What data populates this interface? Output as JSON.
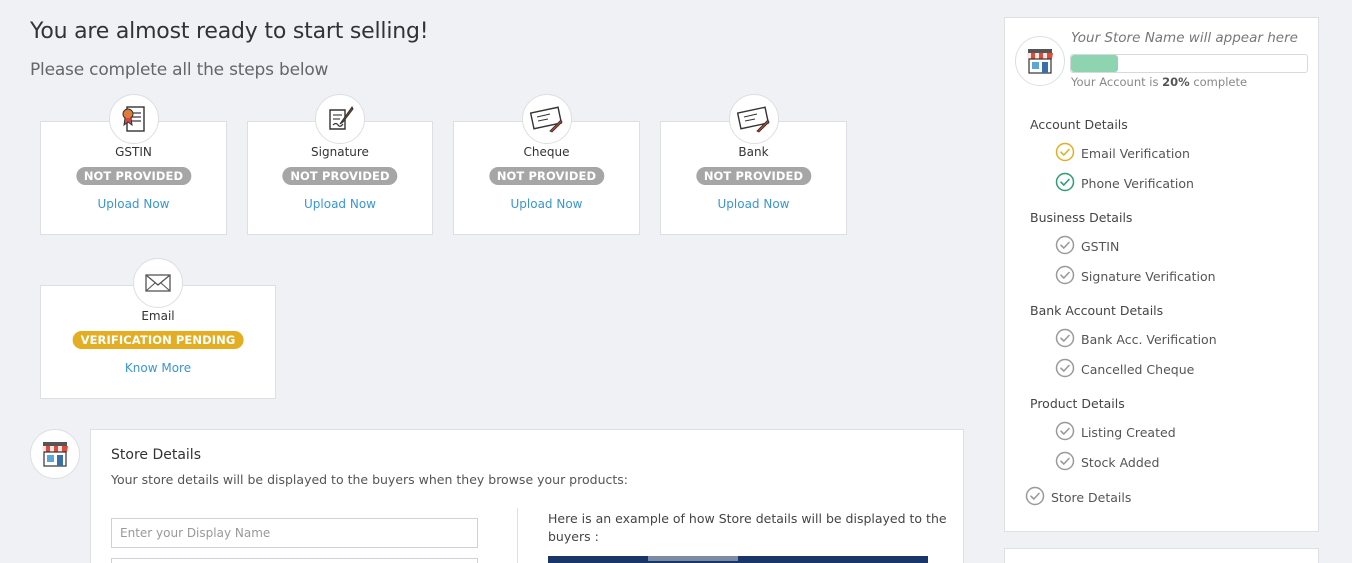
{
  "page": {
    "heading": "You are almost ready to start selling!",
    "subheading": "Please complete all the steps below"
  },
  "cards": [
    {
      "title": "GSTIN",
      "status": "NOT PROVIDED",
      "link": "Upload Now",
      "icon": "certificate-icon"
    },
    {
      "title": "Signature",
      "status": "NOT PROVIDED",
      "link": "Upload Now",
      "icon": "signature-pen-icon"
    },
    {
      "title": "Cheque",
      "status": "NOT PROVIDED",
      "link": "Upload Now",
      "icon": "cheque-icon"
    },
    {
      "title": "Bank",
      "status": "NOT PROVIDED",
      "link": "Upload Now",
      "icon": "bank-cheque-icon"
    },
    {
      "title": "Email",
      "status": "VERIFICATION PENDING",
      "link": "Know More",
      "icon": "envelope-icon"
    }
  ],
  "store": {
    "title": "Store Details",
    "description": "Your store details will be displayed to the buyers when they browse your products:",
    "display_name_placeholder": "Enter your Display Name",
    "example_text": "Here is an example of how Store details will be displayed to the buyers :"
  },
  "sidebar": {
    "store_name_placeholder": "Your Store Name will appear here",
    "progress_prefix": "Your Account is ",
    "progress_percent_label": "20%",
    "progress_suffix": " complete",
    "progress_fraction": 0.2,
    "sections": [
      {
        "label": "Account Details",
        "items": [
          {
            "label": "Email Verification",
            "state": "pending"
          },
          {
            "label": "Phone Verification",
            "state": "done"
          }
        ]
      },
      {
        "label": "Business Details",
        "items": [
          {
            "label": "GSTIN",
            "state": "todo"
          },
          {
            "label": "Signature Verification",
            "state": "todo"
          }
        ]
      },
      {
        "label": "Bank Account Details",
        "items": [
          {
            "label": "Bank Acc. Verification",
            "state": "todo"
          },
          {
            "label": "Cancelled Cheque",
            "state": "todo"
          }
        ]
      },
      {
        "label": "Product Details",
        "items": [
          {
            "label": "Listing Created",
            "state": "todo"
          },
          {
            "label": "Stock Added",
            "state": "todo"
          }
        ]
      }
    ],
    "store_details_item": {
      "label": "Store Details",
      "state": "todo"
    }
  },
  "colors": {
    "pending": "#e4ae24",
    "done": "#2a9d75",
    "todo": "#9a9a9a",
    "link": "#3a96d0",
    "progress_fill": "#8fd4b0"
  }
}
